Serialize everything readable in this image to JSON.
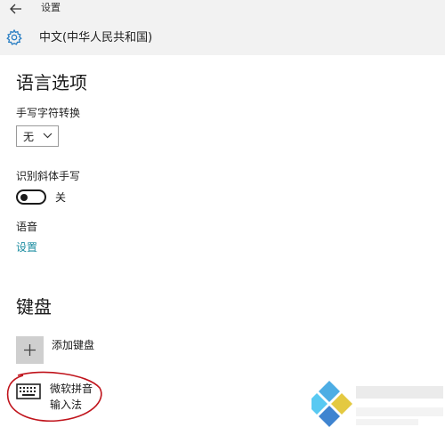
{
  "window": {
    "title": "设置",
    "back_icon": "arrow-left-icon"
  },
  "header": {
    "icon": "gear-icon",
    "title": "中文(中华人民共和国)"
  },
  "language_options": {
    "heading": "语言选项",
    "handwriting_conversion": {
      "label": "手写字符转换",
      "selected": "无"
    },
    "italic_recognition": {
      "label": "识别斜体手写",
      "state_text": "关",
      "on": false
    },
    "speech": {
      "label": "语音",
      "link": "设置"
    }
  },
  "keyboards": {
    "heading": "键盘",
    "add_label": "添加键盘",
    "items": [
      {
        "line1": "微软拼音",
        "line2": "输入法",
        "icon": "keyboard-icon"
      }
    ]
  },
  "colors": {
    "accent_link": "#1a8ca0",
    "topbar": "#f2f2f2",
    "annotation": "#c0141c"
  }
}
